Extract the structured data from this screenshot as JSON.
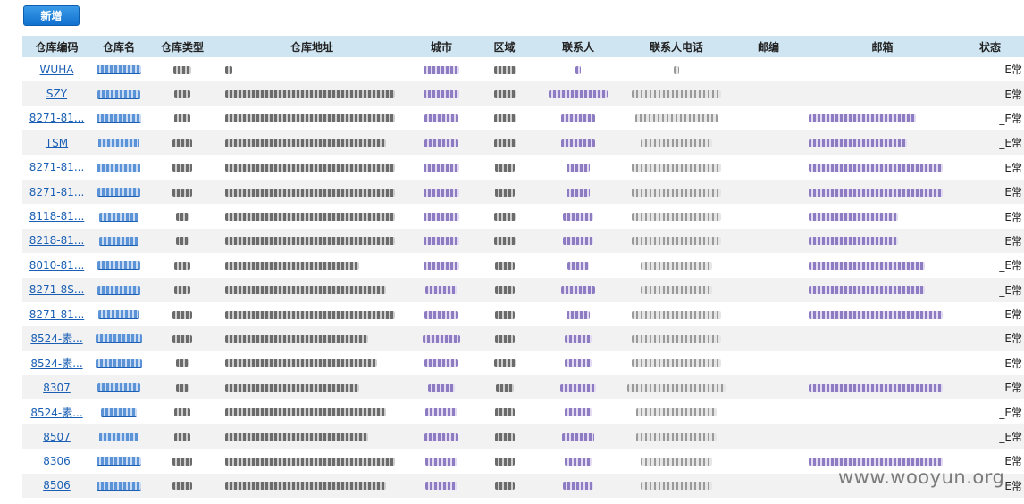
{
  "toolbar": {
    "add_label": "新增"
  },
  "columns": [
    "仓库编码",
    "仓库名",
    "仓库类型",
    "仓库地址",
    "城市",
    "区域",
    "联系人",
    "联系人电话",
    "邮编",
    "邮箱",
    "状态"
  ],
  "rows": [
    {
      "code": "WUHA",
      "status": "E常",
      "has_email": false
    },
    {
      "code": "SZY",
      "status": "E常",
      "has_email": false
    },
    {
      "code": "8271-81...",
      "status": "_E常",
      "has_email": true
    },
    {
      "code": "TSM",
      "status": "_E常",
      "has_email": true
    },
    {
      "code": "8271-81...",
      "status": "E常",
      "has_email": true
    },
    {
      "code": "8271-81...",
      "status": "E常",
      "has_email": true
    },
    {
      "code": "8118-81...",
      "status": "E常",
      "has_email": true
    },
    {
      "code": "8218-81...",
      "status": "E常",
      "has_email": true
    },
    {
      "code": "8010-81...",
      "status": "_E常",
      "has_email": true
    },
    {
      "code": "8271-8S...",
      "status": "_E常",
      "has_email": true
    },
    {
      "code": "8271-81...",
      "status": "E常",
      "has_email": true
    },
    {
      "code": "8524-素...",
      "status": "E常",
      "has_email": false
    },
    {
      "code": "8524-素...",
      "status": "E常",
      "has_email": false
    },
    {
      "code": "8307",
      "status": "E常",
      "has_email": true
    },
    {
      "code": "8524-素...",
      "status": "_E常",
      "has_email": false
    },
    {
      "code": "8507",
      "status": "_E常",
      "has_email": false
    },
    {
      "code": "8306",
      "status": "E常",
      "has_email": true
    },
    {
      "code": "8506",
      "status": "E常",
      "has_email": false
    }
  ],
  "watermark": "www.wooyun.org"
}
